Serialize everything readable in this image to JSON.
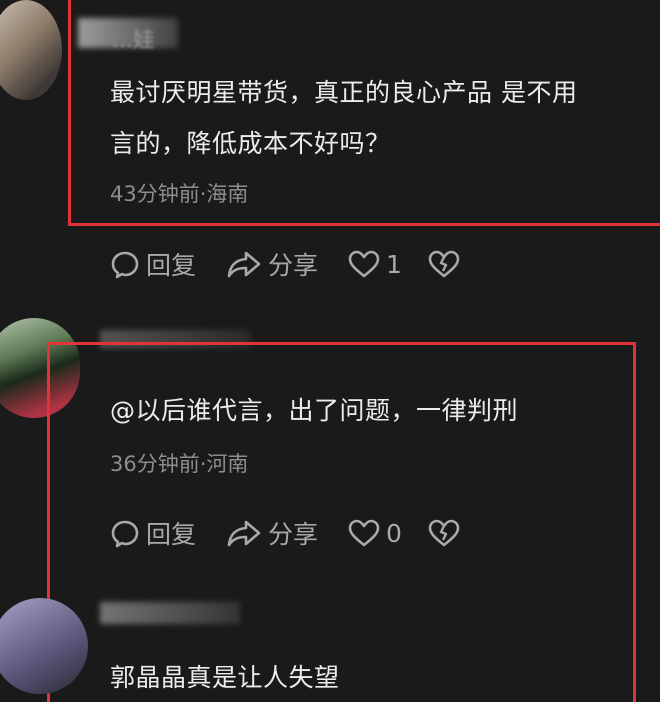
{
  "comments": [
    {
      "username": "...娃",
      "text": "最讨厌明星带货，真正的良心产品 是不用代言的，降低成本不好吗？",
      "line1": "最讨厌明星带货，真正的良心产品 是不用",
      "line2": "言的，降低成本不好吗？",
      "meta": "43分钟前·海南",
      "reply_label": "回复",
      "share_label": "分享",
      "like_count": "1"
    },
    {
      "username": "",
      "text": "@以后谁代言，出了问题，一律判刑",
      "meta": "36分钟前·河南",
      "reply_label": "回复",
      "share_label": "分享",
      "like_count": "0"
    },
    {
      "username": "",
      "text": "郭晶晶真是让人失望"
    }
  ],
  "colors": {
    "background": "#1b1a1a",
    "highlight_box": "#e0333a",
    "text": "#ececec",
    "meta": "#8d8d8d"
  },
  "icons": [
    "reply-icon",
    "share-icon",
    "like-icon",
    "dislike-icon"
  ]
}
